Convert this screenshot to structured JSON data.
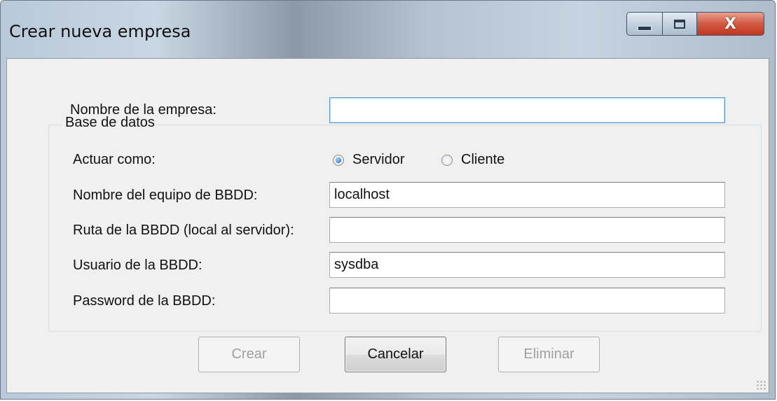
{
  "window": {
    "title": "Crear nueva empresa",
    "minimize_icon": "minimize-icon",
    "maximize_icon": "maximize-icon",
    "close_icon": "close-icon",
    "close_glyph": "X"
  },
  "form": {
    "company_label": "Nombre de la empresa:",
    "company_value": "",
    "group_title": "Base de datos",
    "role_label": "Actuar como:",
    "role_options": [
      {
        "label": "Servidor",
        "selected": true
      },
      {
        "label": "Cliente",
        "selected": false
      }
    ],
    "host_label": "Nombre del equipo de BBDD:",
    "host_value": "localhost",
    "path_label": "Ruta de la BBDD (local al servidor):",
    "path_value": "",
    "user_label": "Usuario de la BBDD:",
    "user_value": "sysdba",
    "password_label": "Password de la BBDD:",
    "password_value": ""
  },
  "buttons": {
    "create": "Crear",
    "cancel": "Cancelar",
    "delete": "Eliminar"
  },
  "colors": {
    "close_button": "#c2361e",
    "focus_border": "#5b9bd5",
    "radio_selected": "#1f63b8",
    "disabled_text": "#a0a0a0"
  }
}
